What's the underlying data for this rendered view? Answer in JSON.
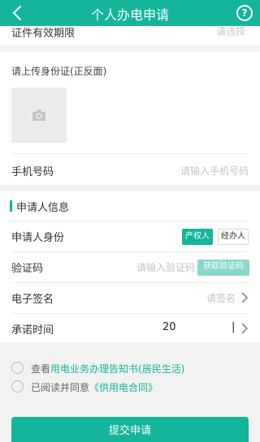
{
  "header": {
    "title": "个人办电申请",
    "help_glyph": "?"
  },
  "peek_row": {
    "label": "证件有效期限",
    "value": "请选择"
  },
  "upload": {
    "label": "请上传身份证(正反面)"
  },
  "phone": {
    "label": "手机号码",
    "placeholder": "请输入手机号码"
  },
  "applicant_section": {
    "title": "申请人信息"
  },
  "identity": {
    "label": "申请人身份",
    "options": [
      "产权人",
      "经办人"
    ],
    "selected": "产权人"
  },
  "verify": {
    "label": "验证码",
    "placeholder": "请输入验证码",
    "get_code_label": "获取验证码"
  },
  "signature": {
    "label": "电子签名",
    "placeholder": "请签名"
  },
  "commit_time": {
    "label": "承诺时间",
    "value": "20",
    "end_marker": "|"
  },
  "agreements": {
    "item1_prefix": "查看",
    "item1_link": "用电业务办理告知书(居民生活)",
    "item2_prefix": "已阅读并同意",
    "item2_link": "《供用电合同》"
  },
  "submit_label": "提交申请",
  "colors": {
    "accent": "#14b59b",
    "accent_light": "#8ad8cb",
    "background": "#f2f2f2"
  }
}
